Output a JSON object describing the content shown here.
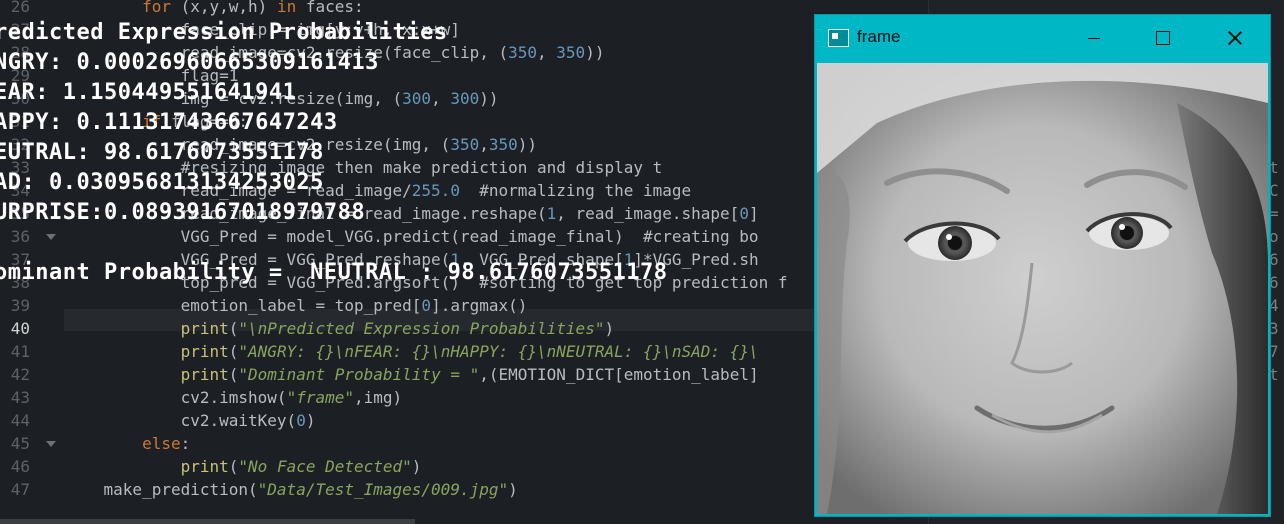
{
  "editor": {
    "lines": [
      {
        "n": "26",
        "parts": [
          [
            "",
            "        "
          ],
          [
            "kw",
            "for"
          ],
          [
            "",
            " (x,y,w,h) "
          ],
          [
            "kw",
            "in"
          ],
          [
            "",
            " faces:"
          ]
        ]
      },
      {
        "n": "27",
        "parts": [
          [
            "",
            "            face_clip = img[y:y+h, x:x+w]"
          ]
        ]
      },
      {
        "n": "28",
        "parts": [
          [
            "",
            "            read_image=cv2.resize(face_clip, ("
          ],
          [
            "num",
            "350"
          ],
          [
            "",
            ", "
          ],
          [
            "num",
            "350"
          ],
          [
            "",
            "))"
          ]
        ]
      },
      {
        "n": "29",
        "parts": [
          [
            "",
            "            flag=1"
          ]
        ]
      },
      {
        "n": "30",
        "parts": [
          [
            "",
            "            img = cv2.resize(img, ("
          ],
          [
            "num",
            "300"
          ],
          [
            "",
            ", "
          ],
          [
            "num",
            "300"
          ],
          [
            "",
            "))"
          ]
        ]
      },
      {
        "n": "31",
        "parts": [
          [
            "",
            "        "
          ],
          [
            "kw",
            "if"
          ],
          [
            "",
            " flag==0:"
          ]
        ]
      },
      {
        "n": "32",
        "parts": [
          [
            "",
            "            read_image=cv2.resize(img, ("
          ],
          [
            "num",
            "350"
          ],
          [
            "",
            ","
          ],
          [
            "num",
            "350"
          ],
          [
            "",
            "))"
          ]
        ]
      },
      {
        "n": "33",
        "parts": [
          [
            "",
            "            #resizing image then make prediction and display t"
          ]
        ]
      },
      {
        "n": "34",
        "parts": [
          [
            "",
            "            read_image = read_image/"
          ],
          [
            "num",
            "255.0"
          ],
          [
            "",
            "  #normalizing the image"
          ]
        ]
      },
      {
        "n": "35",
        "parts": [
          [
            "",
            "            read_image_final = read_image.reshape("
          ],
          [
            "num",
            "1"
          ],
          [
            "",
            ", read_image.shape["
          ],
          [
            "num",
            "0"
          ],
          [
            "",
            "]"
          ]
        ]
      },
      {
        "n": "36",
        "parts": [
          [
            "",
            "            VGG_Pred = model_VGG.predict(read_image_final)  #creating bo"
          ]
        ]
      },
      {
        "n": "37",
        "parts": [
          [
            "",
            "            VGG_Pred = VGG_Pred.reshape("
          ],
          [
            "num",
            "1"
          ],
          [
            "",
            ", VGG_Pred.shape["
          ],
          [
            "num",
            "1"
          ],
          [
            "",
            "]*VGG_Pred.sh"
          ]
        ]
      },
      {
        "n": "38",
        "parts": [
          [
            "",
            "            top_pred = VGG_Pred.argsort()  #sorting to get top prediction f"
          ]
        ]
      },
      {
        "n": "39",
        "parts": [
          [
            "",
            "            emotion_label = top_pred["
          ],
          [
            "num",
            "0"
          ],
          [
            "",
            "].argmax()"
          ]
        ]
      },
      {
        "n": "40",
        "parts": [
          [
            "",
            "            "
          ],
          [
            "fn",
            "print"
          ],
          [
            "",
            "("
          ],
          [
            "str",
            "\"\\nPredicted Expression Probabilities\""
          ],
          [
            "",
            ")"
          ]
        ]
      },
      {
        "n": "41",
        "parts": [
          [
            "",
            "            "
          ],
          [
            "fn",
            "print"
          ],
          [
            "",
            "("
          ],
          [
            "str",
            "\"ANGRY: {}\\nFEAR: {}\\nHAPPY: {}\\nNEUTRAL: {}\\nSAD: {}\\"
          ]
        ]
      },
      {
        "n": "42",
        "parts": [
          [
            "",
            "            "
          ],
          [
            "fn",
            "print"
          ],
          [
            "",
            "("
          ],
          [
            "str",
            "\"Dominant Probability = \""
          ],
          [
            "",
            ",(EMOTION_DICT[emotion_label]"
          ]
        ]
      },
      {
        "n": "43",
        "parts": [
          [
            "",
            "            cv2.imshow("
          ],
          [
            "str",
            "\"frame\""
          ],
          [
            "",
            ",img)"
          ]
        ]
      },
      {
        "n": "44",
        "parts": [
          [
            "",
            "            cv2.waitKey("
          ],
          [
            "num",
            "0"
          ],
          [
            "",
            ")"
          ]
        ]
      },
      {
        "n": "45",
        "parts": [
          [
            "",
            "        "
          ],
          [
            "kw",
            "else"
          ],
          [
            "",
            ":"
          ]
        ]
      },
      {
        "n": "46",
        "parts": [
          [
            "",
            "            "
          ],
          [
            "fn",
            "print"
          ],
          [
            "",
            "("
          ],
          [
            "str",
            "\"No Face Detected\""
          ],
          [
            "",
            ")"
          ]
        ]
      },
      {
        "n": "47",
        "parts": [
          [
            "",
            "    make_prediction("
          ],
          [
            "str",
            "\"Data/Test_Images/009.jpg\""
          ],
          [
            "",
            ")"
          ]
        ]
      }
    ],
    "active_line": "40"
  },
  "right_pane": {
    "fragments": [
      "t",
      "C",
      "=",
      "o",
      "6",
      "6",
      "4",
      "3",
      "7",
      "t"
    ]
  },
  "output": {
    "heading": "redicted Expression Probabilities",
    "angry": "NGRY: 0.00026960665309161413",
    "fear": "EAR: 1.150449551641941",
    "happy": "APPY: 0.11131743667647243",
    "neutral": "EUTRAL: 98.6176073551178",
    "sad": "AD: 0.030956813134253025",
    "surprise": "URPRISE:0.08939167018979788",
    "dominant": "ominant Probability =  NEUTRAL : 98.6176073551178"
  },
  "window": {
    "title": "frame",
    "icon": "app-window-icon",
    "minimize_icon": "minimize-icon",
    "maximize_icon": "maximize-icon",
    "close_icon": "close-icon"
  },
  "colors": {
    "editor_bg": "#1c2024",
    "titlebar": "#00b7c6",
    "output_text": "#ffffff"
  }
}
